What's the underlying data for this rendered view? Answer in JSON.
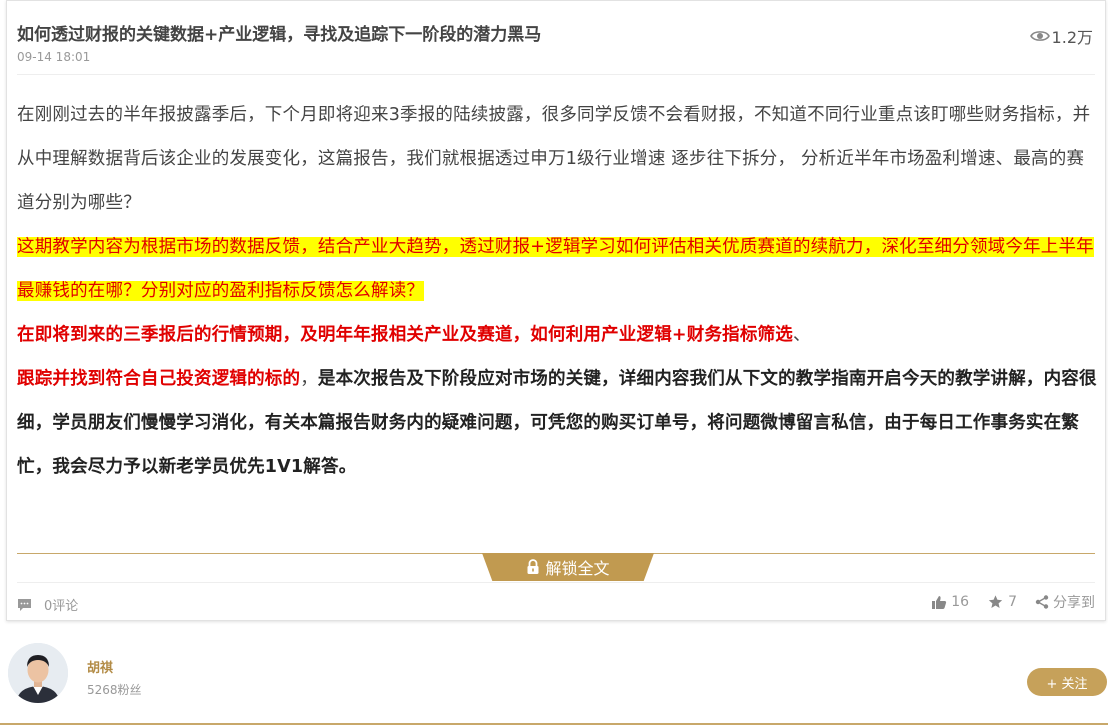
{
  "article": {
    "title": "如何透过财报的关键数据+产业逻辑，寻找及追踪下一阶段的潜力黑马",
    "date": "09-14 18:01",
    "views": "1.2万"
  },
  "content": {
    "p1": "在刚刚过去的半年报披露季后，下个月即将迎来3季报的陆续披露，很多同学反馈不会看财报，不知道不同行业重点该盯哪些财务指标，并从中理解数据背后该企业的发展变化，这篇报告，我们就根据透过申万1级行业增速  逐步往下拆分， 分析近半年市场盈利增速、最高的赛道分别为哪些？",
    "p2": "这期教学内容为根据市场的数据反馈，结合产业大趋势，透过财报+逻辑学习如何评估相关优质赛道的续航力，深化至细分领域今年上半年最赚钱的在哪？分别对应的盈利指标反馈怎么解读？",
    "p3_red": "在即将到来的三季报后的行情预期，及明年年报相关产业及赛道，如何利用产业逻辑+财务指标筛选",
    "p3_tail": "、",
    "p4_red": "跟踪并找到符合自己投资逻辑的标的",
    "p4_comma": "，",
    "p4_dark": "是本次报告及下阶段应对市场的关键，详细内容我们从下文的教学指南开启今天的教学讲解，内容很细，学员朋友们慢慢学习消化，有关本篇报告财务内的疑难问题，可凭您的购买订单号，将问题微博留言私信，由于每日工作事务实在繁忙，我会尽力予以新老学员优先1V1解答。"
  },
  "unlock": {
    "label": "解锁全文"
  },
  "footer": {
    "comments": "0评论",
    "likes": "16",
    "favorites": "7",
    "share": "分享到"
  },
  "author": {
    "name": "胡祺",
    "fans": "5268粉丝",
    "follow_label": "+ 关注"
  },
  "colors": {
    "accent_gold": "#c19a50",
    "highlight_yellow": "#ffff00",
    "emphasis_red": "#e00000"
  }
}
